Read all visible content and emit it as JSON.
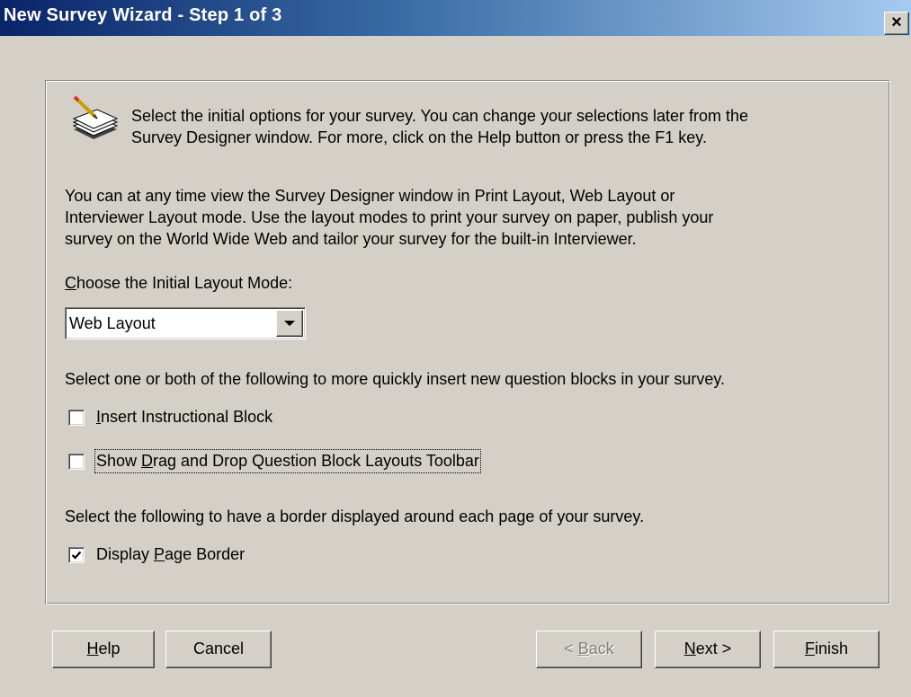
{
  "window": {
    "title": "New Survey Wizard - Step 1 of 3",
    "close_glyph": "×"
  },
  "intro": {
    "icon": "pencil-paper-stack-icon",
    "line1": "Select the initial options for your survey. You can change your selections later from the",
    "line2": "Survey Designer window. For more, click on the Help button or press the F1 key."
  },
  "layout_info": {
    "line1": "You can at any time view the Survey Designer window in Print Layout, Web Layout or",
    "line2": "Interviewer Layout mode. Use the layout modes to print your survey on paper, publish your",
    "line3": "survey on the World Wide Web and tailor your survey for the built-in Interviewer."
  },
  "layout_mode": {
    "label_mnemonic": "C",
    "label_rest": "hoose the Initial Layout Mode:",
    "selected": "Web Layout"
  },
  "blocks": {
    "text": "Select one or both of the following to more quickly insert new question blocks in your survey.",
    "instructional": {
      "mnemonic": "I",
      "rest": "nsert Instructional Block",
      "checked": false
    },
    "drag_drop": {
      "prefix": "Show ",
      "mnemonic": "D",
      "rest": "rag and Drop Question Block Layouts Toolbar",
      "checked": false
    }
  },
  "border": {
    "text": "Select the following to have a border displayed around each page of your survey.",
    "label_prefix": "Display ",
    "mnemonic": "P",
    "label_rest": "age Border",
    "checked": true
  },
  "buttons": {
    "help": {
      "mnemonic": "H",
      "rest": "elp"
    },
    "cancel": {
      "label": "Cancel"
    },
    "back": {
      "prefix": "< ",
      "mnemonic": "B",
      "rest": "ack",
      "enabled": false
    },
    "next": {
      "mnemonic": "N",
      "rest": "ext >"
    },
    "finish": {
      "mnemonic": "F",
      "rest": "inish"
    }
  }
}
